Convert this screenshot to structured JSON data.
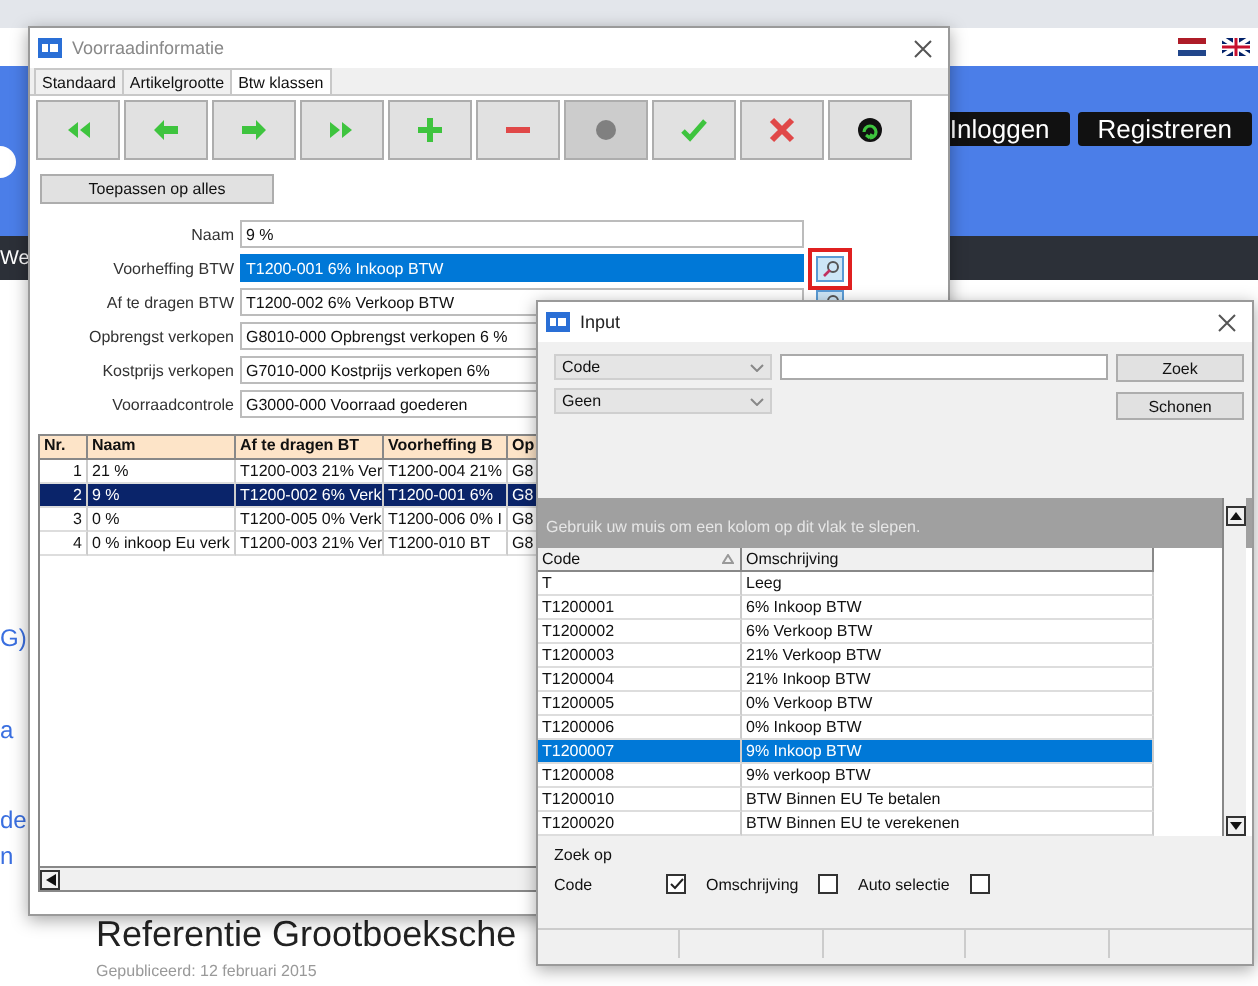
{
  "background_page": {
    "language_flags": [
      {
        "kind": "nl"
      },
      {
        "kind": "uk"
      }
    ],
    "top_buttons": [
      {
        "label": "Inloggen"
      },
      {
        "label": "Registreren"
      }
    ],
    "nav_text": "We",
    "side_links": [
      "G)",
      "a",
      "de",
      "n"
    ],
    "article": {
      "title": "Referentie Grootboeksche",
      "published": "Gepubliceerd: 12 februari 2015"
    }
  },
  "main_window": {
    "title": "Voorraadinformatie",
    "tabs": [
      {
        "label": "Standaard",
        "selected": false
      },
      {
        "label": "Artikelgrootte",
        "selected": false
      },
      {
        "label": "Btw klassen",
        "selected": true
      }
    ],
    "toolbar": [
      {
        "kind": "first",
        "disabled": false
      },
      {
        "kind": "prev",
        "disabled": false
      },
      {
        "kind": "next",
        "disabled": false
      },
      {
        "kind": "last",
        "disabled": false
      },
      {
        "kind": "add",
        "disabled": false
      },
      {
        "kind": "delete",
        "disabled": false
      },
      {
        "kind": "record",
        "disabled": true
      },
      {
        "kind": "confirm",
        "disabled": false
      },
      {
        "kind": "cancel",
        "disabled": false
      },
      {
        "kind": "refresh",
        "disabled": false
      }
    ],
    "apply_button": "Toepassen op alles",
    "fields": [
      {
        "label": "Naam",
        "value": "9 %",
        "selected": false,
        "lookup": false,
        "highlighted": false
      },
      {
        "label": "Voorheffing BTW",
        "value": "T1200-001 6% Inkoop BTW",
        "selected": true,
        "lookup": true,
        "highlighted": true
      },
      {
        "label": "Af te dragen BTW",
        "value": "T1200-002 6% Verkoop BTW",
        "selected": false,
        "lookup": true,
        "highlighted": false
      },
      {
        "label": "Opbrengst verkopen",
        "value": "G8010-000 Opbrengst verkopen 6 %",
        "selected": false,
        "lookup": false,
        "highlighted": false
      },
      {
        "label": "Kostprijs verkopen",
        "value": "G7010-000 Kostprijs verkopen 6%",
        "selected": false,
        "lookup": false,
        "highlighted": false
      },
      {
        "label": "Voorraadcontrole",
        "value": "G3000-000 Voorraad goederen",
        "selected": false,
        "lookup": false,
        "highlighted": false
      }
    ],
    "table": {
      "columns": [
        "Nr.",
        "Naam",
        "Af te dragen BT",
        "Voorheffing B",
        "Op"
      ],
      "rows": [
        {
          "cells": [
            "1",
            "21 %",
            "T1200-003 21% Ver",
            "T1200-004 21%",
            "G8"
          ],
          "selected": false
        },
        {
          "cells": [
            "2",
            "9 %",
            "T1200-002 6% Verk",
            "T1200-001 6%",
            "G8"
          ],
          "selected": true
        },
        {
          "cells": [
            "3",
            "0 %",
            "T1200-005 0% Verk",
            "T1200-006 0% I",
            "G8"
          ],
          "selected": false
        },
        {
          "cells": [
            "4",
            "0 % inkoop Eu verk",
            "T1200-003 21% Ver",
            "T1200-010 BT",
            "G8"
          ],
          "selected": false
        }
      ]
    }
  },
  "input_dialog": {
    "title": "Input",
    "dropdowns": [
      "Code",
      "Geen"
    ],
    "buttons": [
      "Zoek",
      "Schonen"
    ],
    "group_hint": "Gebruik uw muis om een kolom op dit vlak te slepen.",
    "grid": {
      "columns": [
        {
          "label": "Code",
          "sorted": true
        },
        {
          "label": "Omschrijving",
          "sorted": false
        }
      ],
      "rows": [
        {
          "code": "T",
          "description": "Leeg",
          "selected": false
        },
        {
          "code": "T1200001",
          "description": "6% Inkoop BTW",
          "selected": false
        },
        {
          "code": "T1200002",
          "description": "6% Verkoop BTW",
          "selected": false
        },
        {
          "code": "T1200003",
          "description": "21% Verkoop BTW",
          "selected": false
        },
        {
          "code": "T1200004",
          "description": "21% Inkoop BTW",
          "selected": false
        },
        {
          "code": "T1200005",
          "description": "0% Verkoop BTW",
          "selected": false
        },
        {
          "code": "T1200006",
          "description": "0% Inkoop BTW",
          "selected": false
        },
        {
          "code": "T1200007",
          "description": "9% Inkoop BTW",
          "selected": true
        },
        {
          "code": "T1200008",
          "description": "9% verkoop BTW",
          "selected": false
        },
        {
          "code": "T1200010",
          "description": "BTW Binnen EU Te betalen",
          "selected": false
        },
        {
          "code": "T1200020",
          "description": "BTW Binnen EU te verekenen",
          "selected": false
        }
      ]
    },
    "search_by": {
      "label": "Zoek op",
      "options": [
        {
          "label": "Code",
          "checked": true
        },
        {
          "label": "Omschrijving",
          "checked": false
        },
        {
          "label": "Auto selectie",
          "checked": false
        }
      ]
    }
  }
}
